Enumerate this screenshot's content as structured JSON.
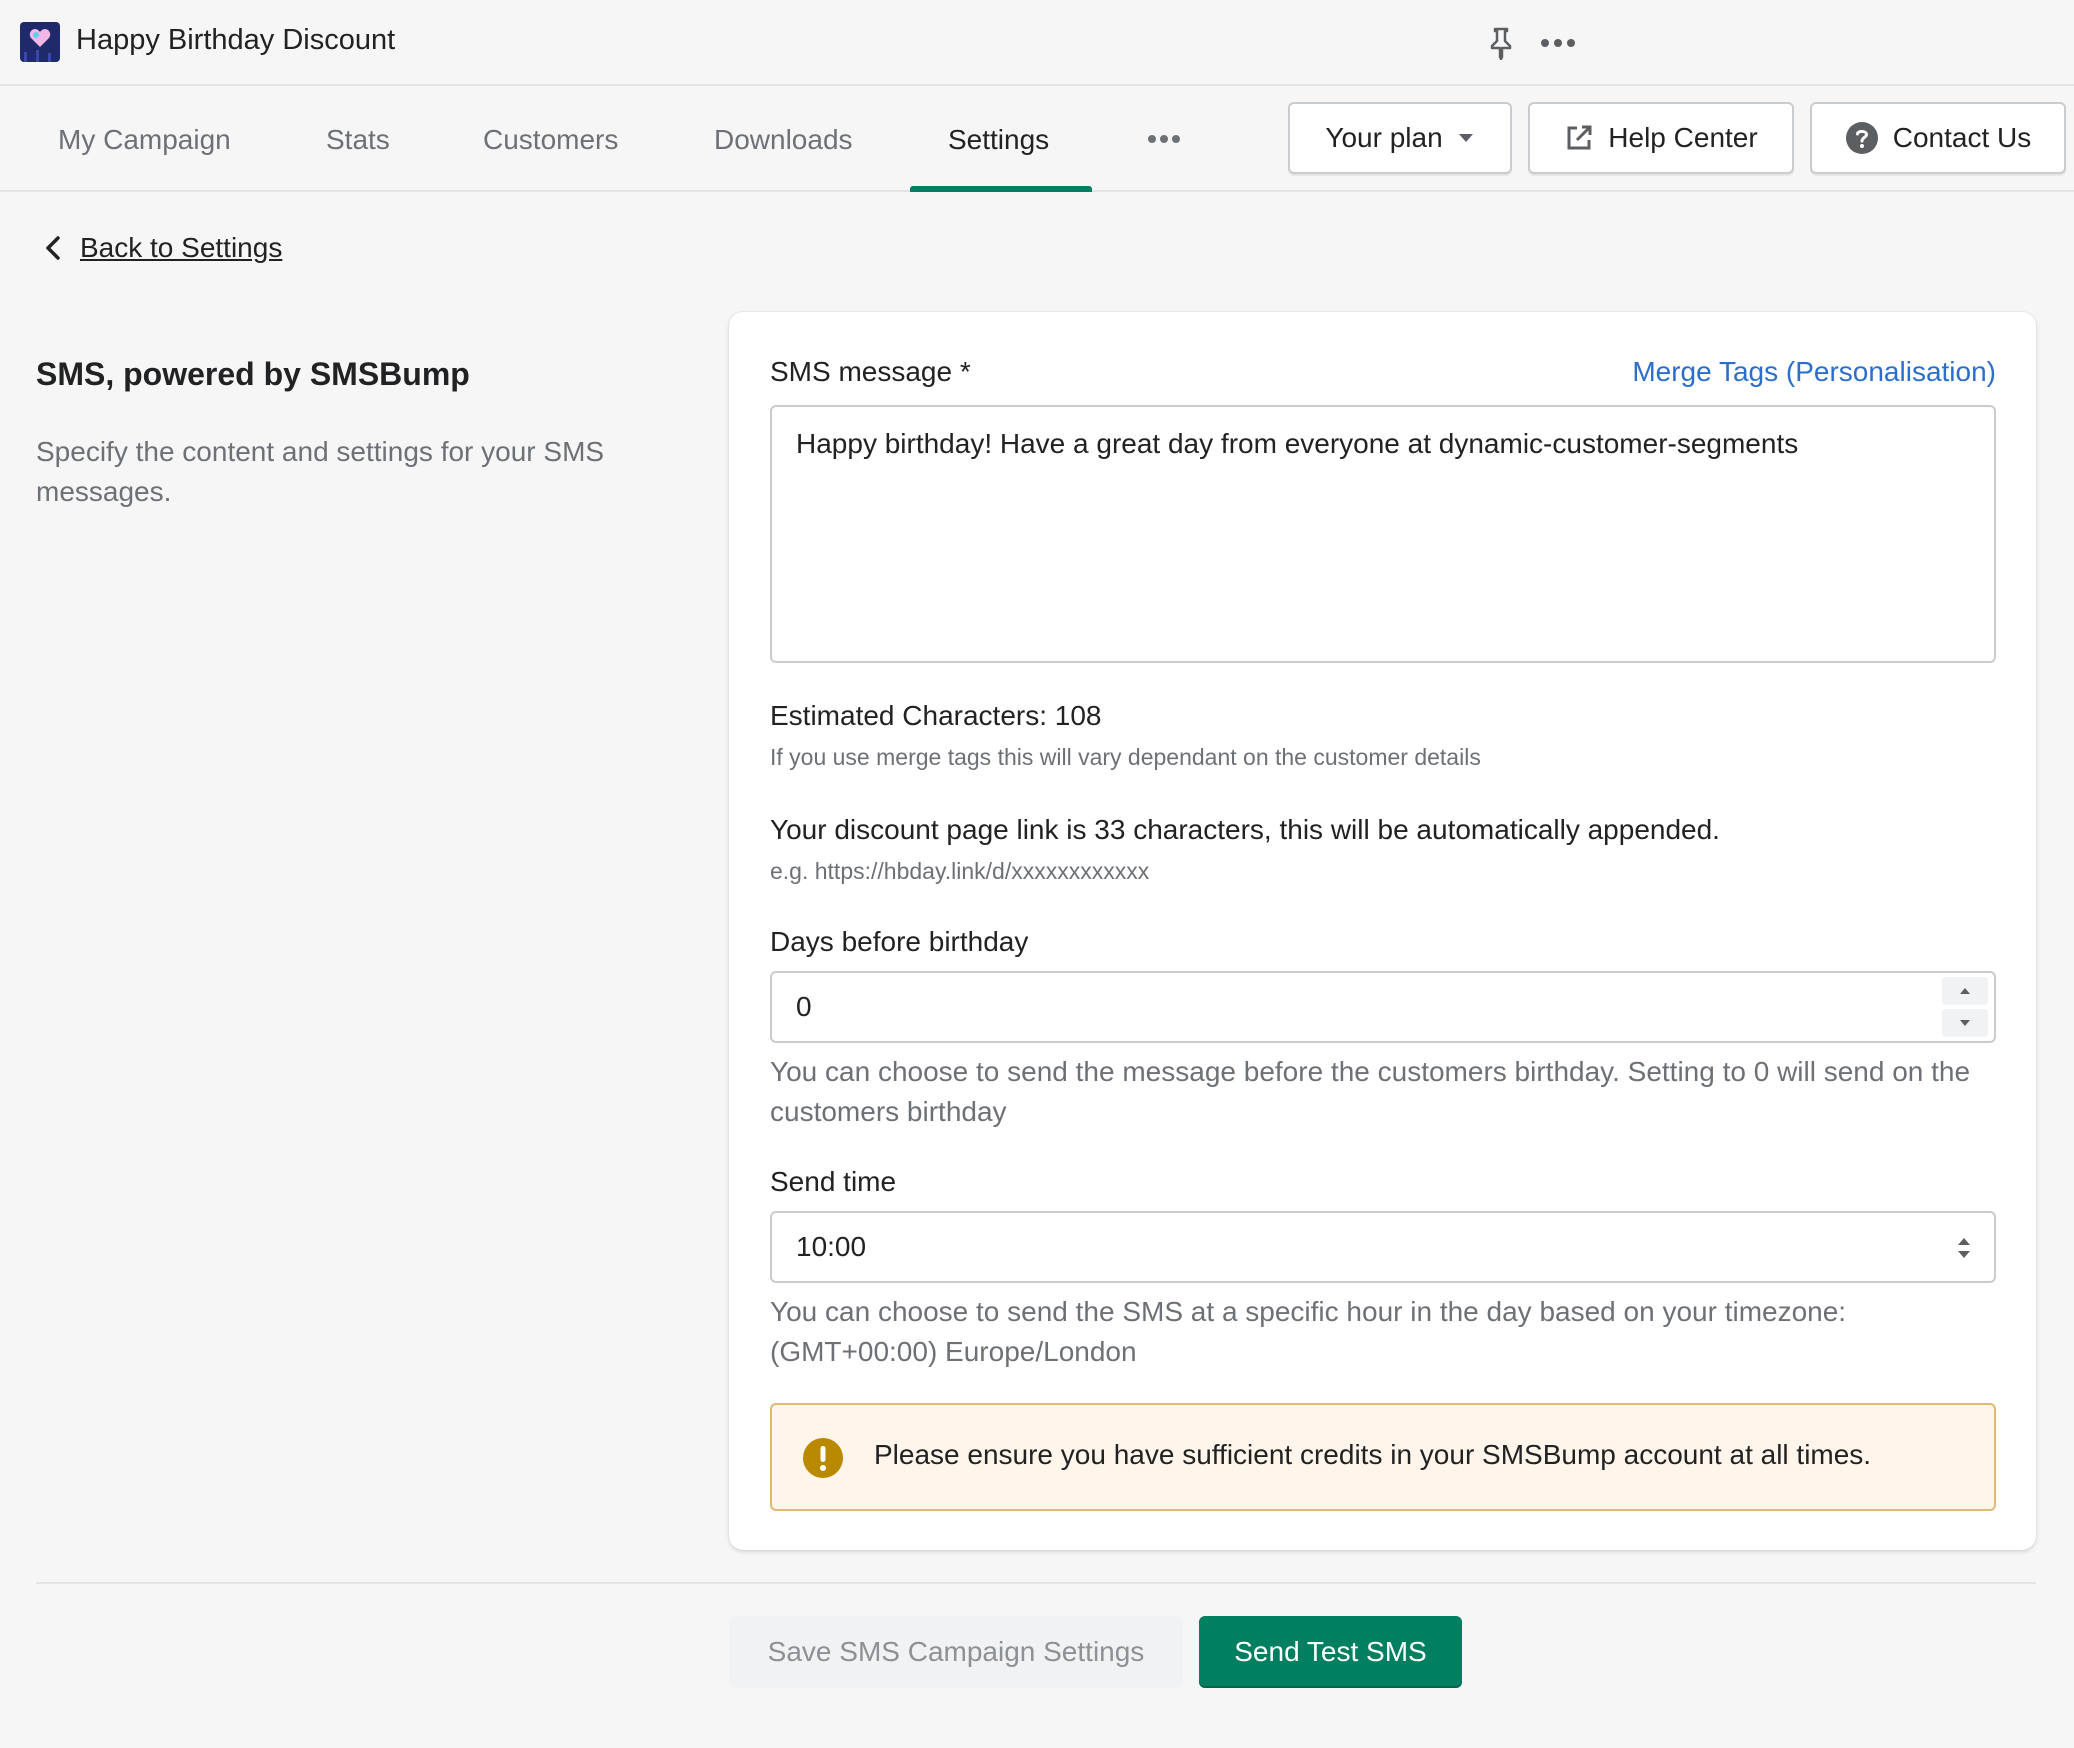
{
  "app": {
    "title": "Happy Birthday Discount"
  },
  "nav": {
    "tabs": [
      {
        "label": "My Campaign"
      },
      {
        "label": "Stats"
      },
      {
        "label": "Customers"
      },
      {
        "label": "Downloads"
      },
      {
        "label": "Settings"
      }
    ],
    "active_tab": "Settings",
    "plan_label": "Your plan",
    "help_label": "Help Center",
    "contact_label": "Contact Us"
  },
  "back": {
    "label": "Back to Settings"
  },
  "section": {
    "title": "SMS, powered by SMSBump",
    "description": "Specify the content and settings for your SMS messages."
  },
  "form": {
    "message_label": "SMS message *",
    "merge_tags_label": "Merge Tags (Personalisation)",
    "message_value": "Happy birthday! Have a great day from everyone at dynamic-customer-segments",
    "estimated_chars": "Estimated Characters: 108",
    "merge_note": "If you use merge tags this will vary dependant on the customer details",
    "link_info": "Your discount page link is 33 characters, this will be automatically appended.",
    "link_example": "e.g. https://hbday.link/d/xxxxxxxxxxxx",
    "days_label": "Days before birthday",
    "days_value": "0",
    "days_help": "You can choose to send the message before the customers birthday. Setting to 0 will send on the customers birthday",
    "send_time_label": "Send time",
    "send_time_value": "10:00",
    "send_time_help": "You can choose to send the SMS at a specific hour in the day based on your timezone: (GMT+00:00) Europe/London",
    "warning": "Please ensure you have sufficient credits in your SMSBump account at all times."
  },
  "footer": {
    "save_label": "Save SMS Campaign Settings",
    "test_label": "Send Test SMS"
  },
  "colors": {
    "primary": "#008060",
    "link": "#2c6ecb",
    "warning_bg": "#fff5ea",
    "warning_icon": "#b98900"
  },
  "icons": [
    "app-logo",
    "pin-icon",
    "more-icon",
    "chevron-down-icon",
    "external-link-icon",
    "question-icon",
    "chevron-left-icon",
    "stepper-up-icon",
    "stepper-down-icon",
    "select-arrows-icon",
    "warning-icon"
  ]
}
